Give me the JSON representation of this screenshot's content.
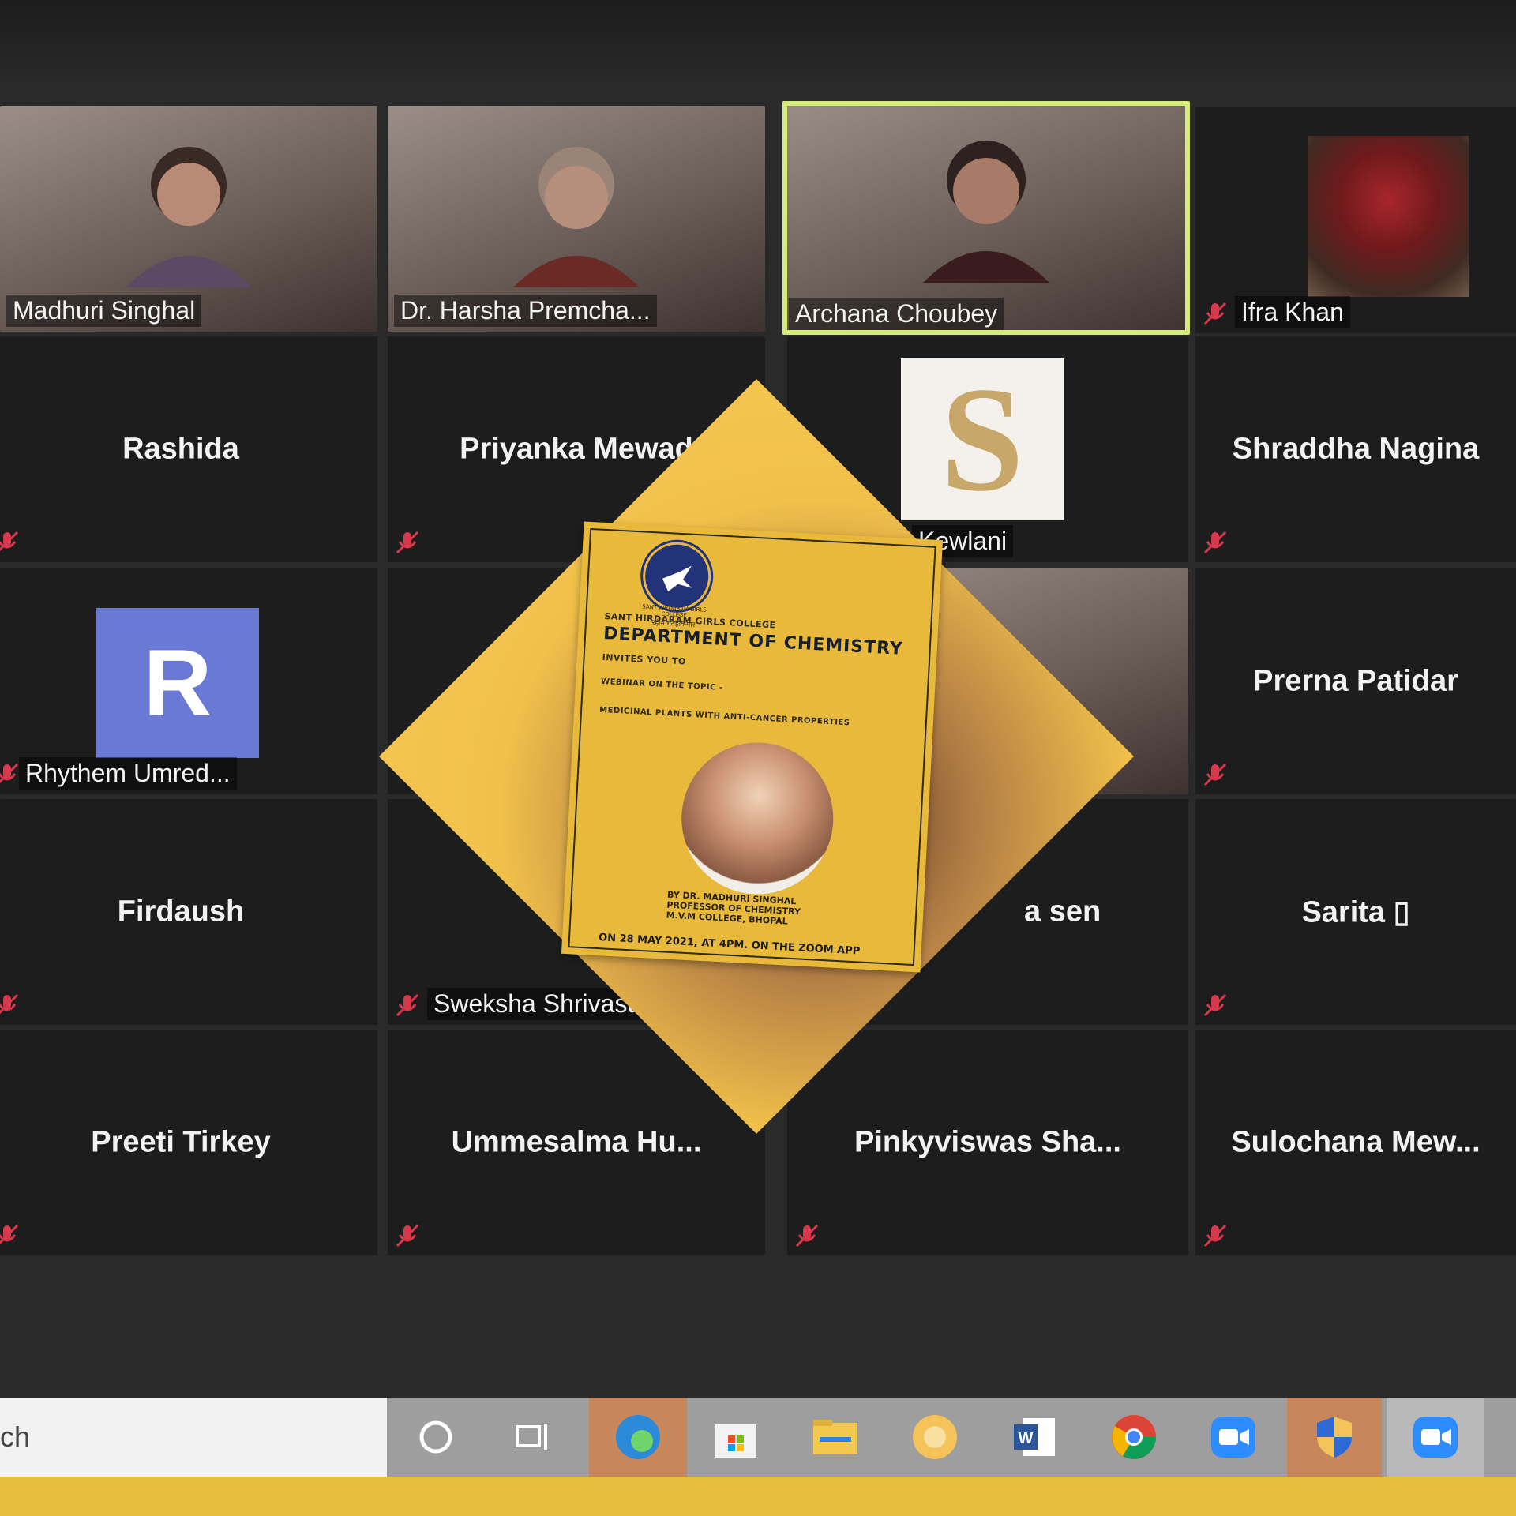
{
  "participants": [
    {
      "name": "Madhuri Singhal",
      "kind": "video"
    },
    {
      "name": "Dr. Harsha Premcha...",
      "kind": "video"
    },
    {
      "name": "Archana Choubey",
      "kind": "video",
      "active": true
    },
    {
      "name": "Ifra Khan",
      "kind": "image",
      "muted": true
    },
    {
      "name": "Rashida",
      "kind": "name",
      "muted": true
    },
    {
      "name": "Priyanka Mewad",
      "kind": "name",
      "muted": true
    },
    {
      "name": "Kewlani",
      "kind": "image-s",
      "initial": "S"
    },
    {
      "name": "Shraddha Nagina",
      "kind": "name",
      "muted": true
    },
    {
      "name": "Rhythem Umred...",
      "kind": "avatar",
      "initial": "R",
      "muted": true
    },
    {
      "name": "",
      "kind": "blank"
    },
    {
      "name": "",
      "kind": "video"
    },
    {
      "name": "Prerna Patidar",
      "kind": "name",
      "muted": true
    },
    {
      "name": "Firdaush",
      "kind": "name",
      "muted": true
    },
    {
      "name": "Sweksha Shrivast",
      "kind": "video",
      "muted": true
    },
    {
      "name": "a sen",
      "kind": "name"
    },
    {
      "name": "Sarita ▯",
      "kind": "name",
      "muted": true
    },
    {
      "name": "Preeti Tirkey",
      "kind": "name",
      "muted": true
    },
    {
      "name": "Ummesalma  Hu...",
      "kind": "name",
      "muted": true
    },
    {
      "name": "Pinkyviswas  Sha...",
      "kind": "name",
      "muted": true
    },
    {
      "name": "Sulochana  Mew...",
      "kind": "name",
      "muted": true
    }
  ],
  "taskbar": {
    "search_text": "ch",
    "icons": [
      "cortana-icon",
      "task-view-icon",
      "edge-icon",
      "store-icon",
      "file-explorer-icon",
      "app-icon",
      "word-icon",
      "chrome-icon",
      "zoom-icon",
      "security-icon",
      "zoom-icon-2"
    ]
  },
  "poster": {
    "logo_text": "SANT HIRDARAM GIRLS COLLEGE",
    "logo_motto": "रहीम गतहीकमार",
    "college": "SANT HIRDARAM GIRLS COLLEGE",
    "department": "DEPARTMENT OF CHEMISTRY",
    "invites": "INVITES YOU TO",
    "webinar": "WEBINAR ON THE TOPIC -",
    "topic": "MEDICINAL PLANTS WITH ANTI-CANCER PROPERTIES",
    "speaker_1": "BY DR. MADHURI SINGHAL",
    "speaker_2": "PROFESSOR OF CHEMISTRY",
    "speaker_3": "M.V.M COLLEGE, BHOPAL",
    "date": "ON 28 MAY 2021, AT 4PM. ON THE ZOOM APP"
  },
  "colors": {
    "accent_yellow": "#f0c04a",
    "active_border": "#d6ec7a",
    "muted_red": "#d8384c",
    "avatar_blue": "#6a79d4"
  }
}
